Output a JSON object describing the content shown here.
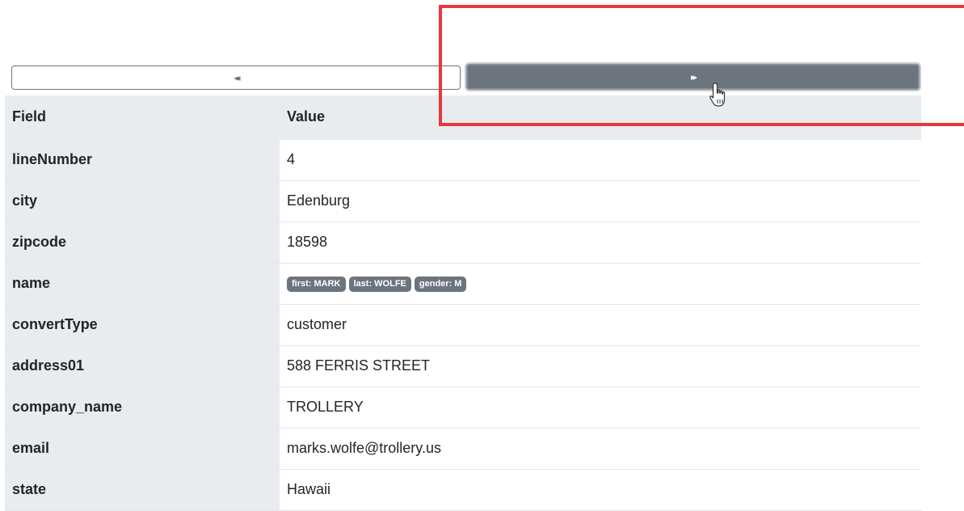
{
  "navigation": {
    "prev_icon": "double-chevron-left-icon",
    "prev_glyph": "◂◂",
    "next_icon": "double-chevron-right-icon",
    "next_glyph": "▸▸"
  },
  "table": {
    "headers": {
      "field": "Field",
      "value": "Value"
    },
    "rows": [
      {
        "field": "lineNumber",
        "value": "4"
      },
      {
        "field": "city",
        "value": "Edenburg"
      },
      {
        "field": "zipcode",
        "value": "18598"
      },
      {
        "field": "name",
        "badges": [
          "first: MARK",
          "last: WOLFE",
          "gender: M"
        ]
      },
      {
        "field": "convertType",
        "value": "customer"
      },
      {
        "field": "address01",
        "value": "588 FERRIS STREET"
      },
      {
        "field": "company_name",
        "value": "TROLLERY"
      },
      {
        "field": "email",
        "value": "marks.wolfe@trollery.us"
      },
      {
        "field": "state",
        "value": "Hawaii"
      }
    ]
  },
  "colors": {
    "button_secondary": "#6c757d",
    "header_background": "#e9ecef",
    "highlight_border": "#e8383d"
  }
}
